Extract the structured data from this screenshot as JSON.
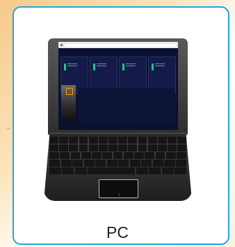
{
  "device_label": "PC",
  "screen": {
    "panels": [
      {
        "title": "",
        "temperature": ""
      },
      {
        "title": "",
        "temperature": ""
      },
      {
        "title": "",
        "temperature": ""
      },
      {
        "title": "",
        "temperature": ""
      }
    ]
  },
  "colors": {
    "card_border": "#21a6de",
    "screen_bg": "#0c1030",
    "temperature_text": "#29c3ff",
    "status_indicator": "#1fc58e"
  },
  "icons": [
    "laptop-icon",
    "camera-feed-image",
    "thermometer-icon"
  ]
}
